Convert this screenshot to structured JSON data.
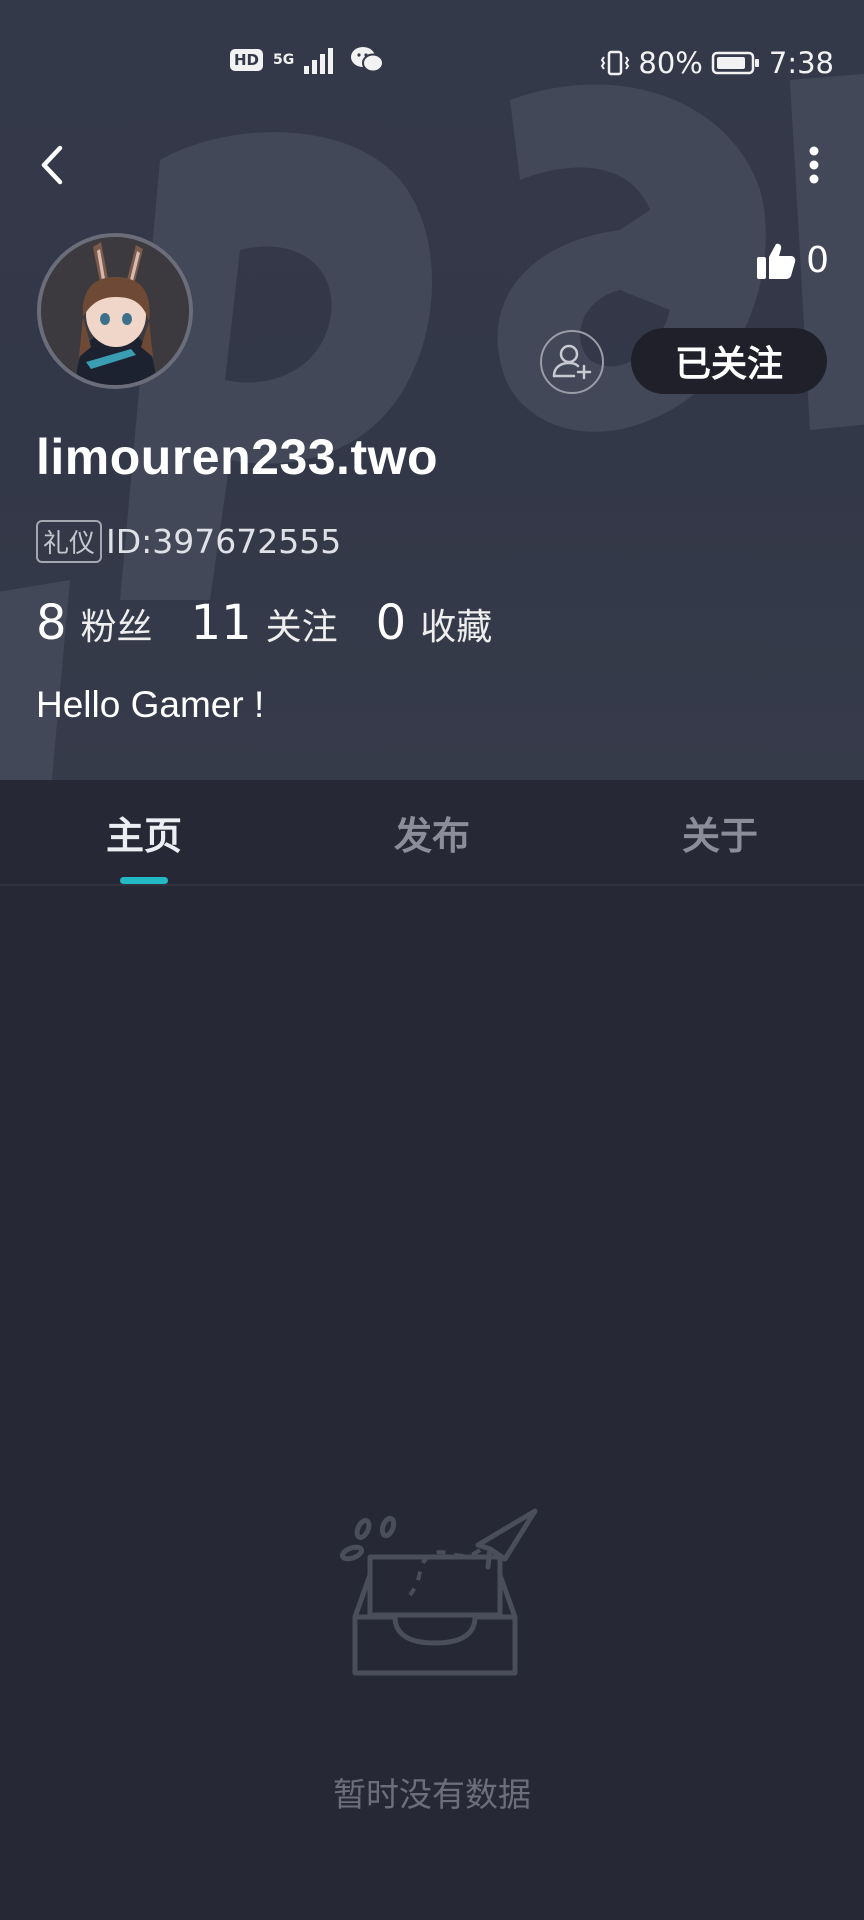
{
  "status_bar": {
    "hd": "HD",
    "network": "5G",
    "battery": "80%",
    "time": "7:38"
  },
  "profile": {
    "likes_count": "0",
    "follow_button_label": "已关注",
    "username": "limouren233.two",
    "badge": "礼仪",
    "id_text": "ID:397672555",
    "bio": "Hello Gamer !"
  },
  "stats": [
    {
      "value": "8",
      "label": "粉丝"
    },
    {
      "value": "11",
      "label": "关注"
    },
    {
      "value": "0",
      "label": "收藏"
    }
  ],
  "tabs": [
    {
      "label": "主页",
      "active": true
    },
    {
      "label": "发布",
      "active": false
    },
    {
      "label": "关于",
      "active": false
    }
  ],
  "empty_state": {
    "message": "暂时没有数据"
  },
  "colors": {
    "accent": "#22b8c4",
    "header_bg": "#343949",
    "body_bg": "#262835"
  }
}
